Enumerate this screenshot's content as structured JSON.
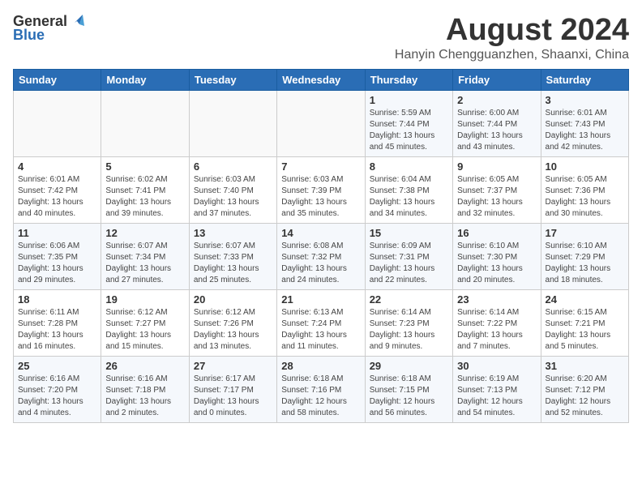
{
  "header": {
    "logo_general": "General",
    "logo_blue": "Blue",
    "month_year": "August 2024",
    "location": "Hanyin Chengguanzhen, Shaanxi, China"
  },
  "days_of_week": [
    "Sunday",
    "Monday",
    "Tuesday",
    "Wednesday",
    "Thursday",
    "Friday",
    "Saturday"
  ],
  "weeks": [
    [
      {
        "day": "",
        "info": ""
      },
      {
        "day": "",
        "info": ""
      },
      {
        "day": "",
        "info": ""
      },
      {
        "day": "",
        "info": ""
      },
      {
        "day": "1",
        "info": "Sunrise: 5:59 AM\nSunset: 7:44 PM\nDaylight: 13 hours\nand 45 minutes."
      },
      {
        "day": "2",
        "info": "Sunrise: 6:00 AM\nSunset: 7:44 PM\nDaylight: 13 hours\nand 43 minutes."
      },
      {
        "day": "3",
        "info": "Sunrise: 6:01 AM\nSunset: 7:43 PM\nDaylight: 13 hours\nand 42 minutes."
      }
    ],
    [
      {
        "day": "4",
        "info": "Sunrise: 6:01 AM\nSunset: 7:42 PM\nDaylight: 13 hours\nand 40 minutes."
      },
      {
        "day": "5",
        "info": "Sunrise: 6:02 AM\nSunset: 7:41 PM\nDaylight: 13 hours\nand 39 minutes."
      },
      {
        "day": "6",
        "info": "Sunrise: 6:03 AM\nSunset: 7:40 PM\nDaylight: 13 hours\nand 37 minutes."
      },
      {
        "day": "7",
        "info": "Sunrise: 6:03 AM\nSunset: 7:39 PM\nDaylight: 13 hours\nand 35 minutes."
      },
      {
        "day": "8",
        "info": "Sunrise: 6:04 AM\nSunset: 7:38 PM\nDaylight: 13 hours\nand 34 minutes."
      },
      {
        "day": "9",
        "info": "Sunrise: 6:05 AM\nSunset: 7:37 PM\nDaylight: 13 hours\nand 32 minutes."
      },
      {
        "day": "10",
        "info": "Sunrise: 6:05 AM\nSunset: 7:36 PM\nDaylight: 13 hours\nand 30 minutes."
      }
    ],
    [
      {
        "day": "11",
        "info": "Sunrise: 6:06 AM\nSunset: 7:35 PM\nDaylight: 13 hours\nand 29 minutes."
      },
      {
        "day": "12",
        "info": "Sunrise: 6:07 AM\nSunset: 7:34 PM\nDaylight: 13 hours\nand 27 minutes."
      },
      {
        "day": "13",
        "info": "Sunrise: 6:07 AM\nSunset: 7:33 PM\nDaylight: 13 hours\nand 25 minutes."
      },
      {
        "day": "14",
        "info": "Sunrise: 6:08 AM\nSunset: 7:32 PM\nDaylight: 13 hours\nand 24 minutes."
      },
      {
        "day": "15",
        "info": "Sunrise: 6:09 AM\nSunset: 7:31 PM\nDaylight: 13 hours\nand 22 minutes."
      },
      {
        "day": "16",
        "info": "Sunrise: 6:10 AM\nSunset: 7:30 PM\nDaylight: 13 hours\nand 20 minutes."
      },
      {
        "day": "17",
        "info": "Sunrise: 6:10 AM\nSunset: 7:29 PM\nDaylight: 13 hours\nand 18 minutes."
      }
    ],
    [
      {
        "day": "18",
        "info": "Sunrise: 6:11 AM\nSunset: 7:28 PM\nDaylight: 13 hours\nand 16 minutes."
      },
      {
        "day": "19",
        "info": "Sunrise: 6:12 AM\nSunset: 7:27 PM\nDaylight: 13 hours\nand 15 minutes."
      },
      {
        "day": "20",
        "info": "Sunrise: 6:12 AM\nSunset: 7:26 PM\nDaylight: 13 hours\nand 13 minutes."
      },
      {
        "day": "21",
        "info": "Sunrise: 6:13 AM\nSunset: 7:24 PM\nDaylight: 13 hours\nand 11 minutes."
      },
      {
        "day": "22",
        "info": "Sunrise: 6:14 AM\nSunset: 7:23 PM\nDaylight: 13 hours\nand 9 minutes."
      },
      {
        "day": "23",
        "info": "Sunrise: 6:14 AM\nSunset: 7:22 PM\nDaylight: 13 hours\nand 7 minutes."
      },
      {
        "day": "24",
        "info": "Sunrise: 6:15 AM\nSunset: 7:21 PM\nDaylight: 13 hours\nand 5 minutes."
      }
    ],
    [
      {
        "day": "25",
        "info": "Sunrise: 6:16 AM\nSunset: 7:20 PM\nDaylight: 13 hours\nand 4 minutes."
      },
      {
        "day": "26",
        "info": "Sunrise: 6:16 AM\nSunset: 7:18 PM\nDaylight: 13 hours\nand 2 minutes."
      },
      {
        "day": "27",
        "info": "Sunrise: 6:17 AM\nSunset: 7:17 PM\nDaylight: 13 hours\nand 0 minutes."
      },
      {
        "day": "28",
        "info": "Sunrise: 6:18 AM\nSunset: 7:16 PM\nDaylight: 12 hours\nand 58 minutes."
      },
      {
        "day": "29",
        "info": "Sunrise: 6:18 AM\nSunset: 7:15 PM\nDaylight: 12 hours\nand 56 minutes."
      },
      {
        "day": "30",
        "info": "Sunrise: 6:19 AM\nSunset: 7:13 PM\nDaylight: 12 hours\nand 54 minutes."
      },
      {
        "day": "31",
        "info": "Sunrise: 6:20 AM\nSunset: 7:12 PM\nDaylight: 12 hours\nand 52 minutes."
      }
    ]
  ]
}
